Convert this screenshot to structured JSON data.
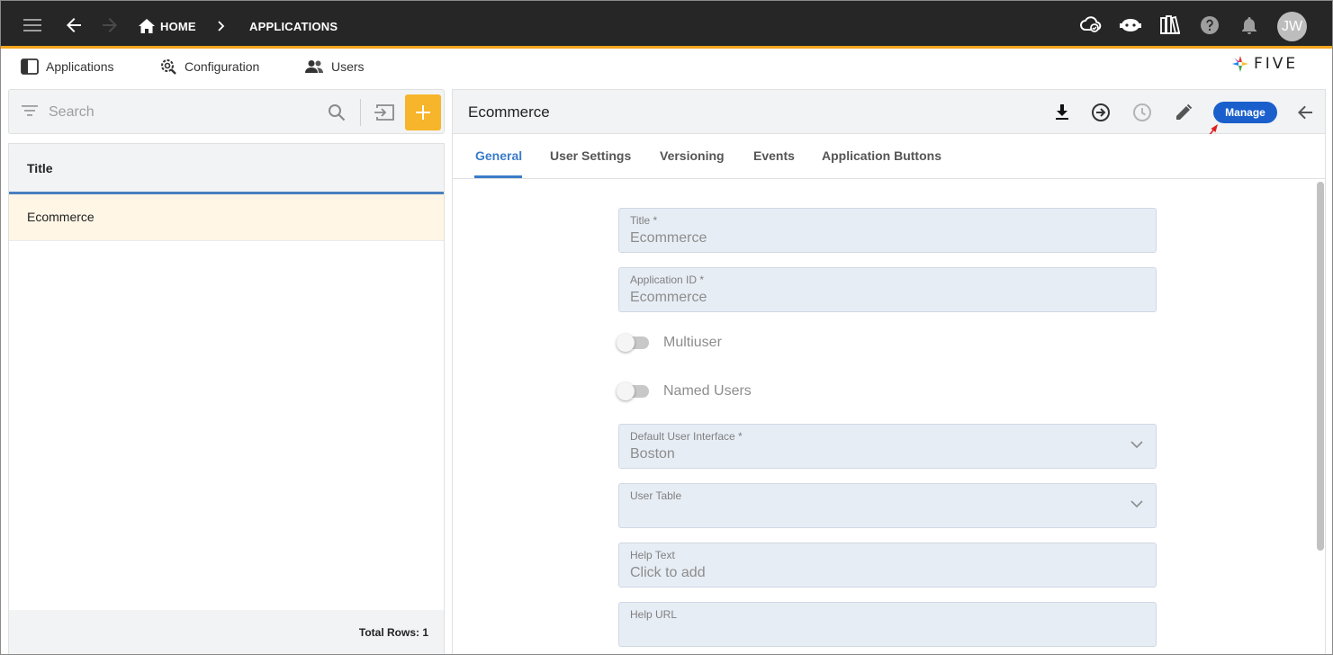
{
  "topbar": {
    "home_label": "HOME",
    "applications_label": "APPLICATIONS",
    "avatar_initials": "JW",
    "accent_color": "#f4a51c"
  },
  "nav": {
    "applications": "Applications",
    "configuration": "Configuration",
    "users": "Users",
    "logo_text": "FIVE"
  },
  "left": {
    "search_placeholder": "Search",
    "column_title": "Title",
    "rows": [
      "Ecommerce"
    ],
    "total_rows": "Total Rows: 1"
  },
  "right": {
    "title": "Ecommerce",
    "manage_label": "Manage",
    "tabs": [
      "General",
      "User Settings",
      "Versioning",
      "Events",
      "Application Buttons"
    ],
    "active_tab": "General"
  },
  "form": {
    "title_label": "Title *",
    "title_value": "Ecommerce",
    "appid_label": "Application ID *",
    "appid_value": "Ecommerce",
    "multiuser_label": "Multiuser",
    "named_users_label": "Named Users",
    "ui_label": "Default User Interface *",
    "ui_value": "Boston",
    "user_table_label": "User Table",
    "user_table_value": "",
    "help_text_label": "Help Text",
    "help_text_value": "Click to add",
    "help_url_label": "Help URL",
    "help_url_value": ""
  }
}
